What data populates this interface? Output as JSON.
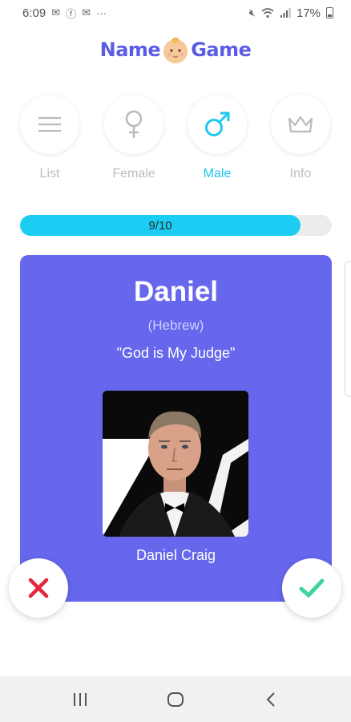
{
  "status_bar": {
    "time": "6:09",
    "notification_icons": [
      "mail-icon",
      "facebook-icon",
      "mail-icon"
    ],
    "overflow": "···",
    "battery": "17%"
  },
  "logo": {
    "left": "Name",
    "right": "Game"
  },
  "nav": {
    "items": [
      {
        "label": "List",
        "icon": "list-icon"
      },
      {
        "label": "Female",
        "icon": "female-icon"
      },
      {
        "label": "Male",
        "icon": "male-icon",
        "active": true
      },
      {
        "label": "Info",
        "icon": "crown-icon"
      }
    ]
  },
  "progress": {
    "text": "9/10",
    "value": 0.9
  },
  "card": {
    "name": "Daniel",
    "origin": "(Hebrew)",
    "meaning": "\"God is My Judge\"",
    "caption": "Daniel Craig",
    "background_color": "#6667ec"
  },
  "colors": {
    "accent": "#1ccdf3",
    "brand": "#5b5ce6",
    "reject": "#e8243a",
    "accept": "#3ed49a"
  }
}
